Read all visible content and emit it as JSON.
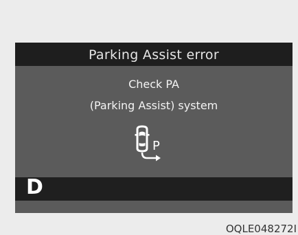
{
  "display": {
    "title": "Parking Assist error",
    "message_line_1": "Check PA",
    "message_line_2": "(Parking Assist) system",
    "icon": "parking-assist-warning-icon",
    "icon_letter": "P",
    "gear": "D"
  },
  "caption": "OQLE048272I",
  "colors": {
    "page_background": "#ececec",
    "title_bar": "#1e1e1e",
    "message_panel": "#5b5b5b",
    "text": "#f4f4f4"
  }
}
